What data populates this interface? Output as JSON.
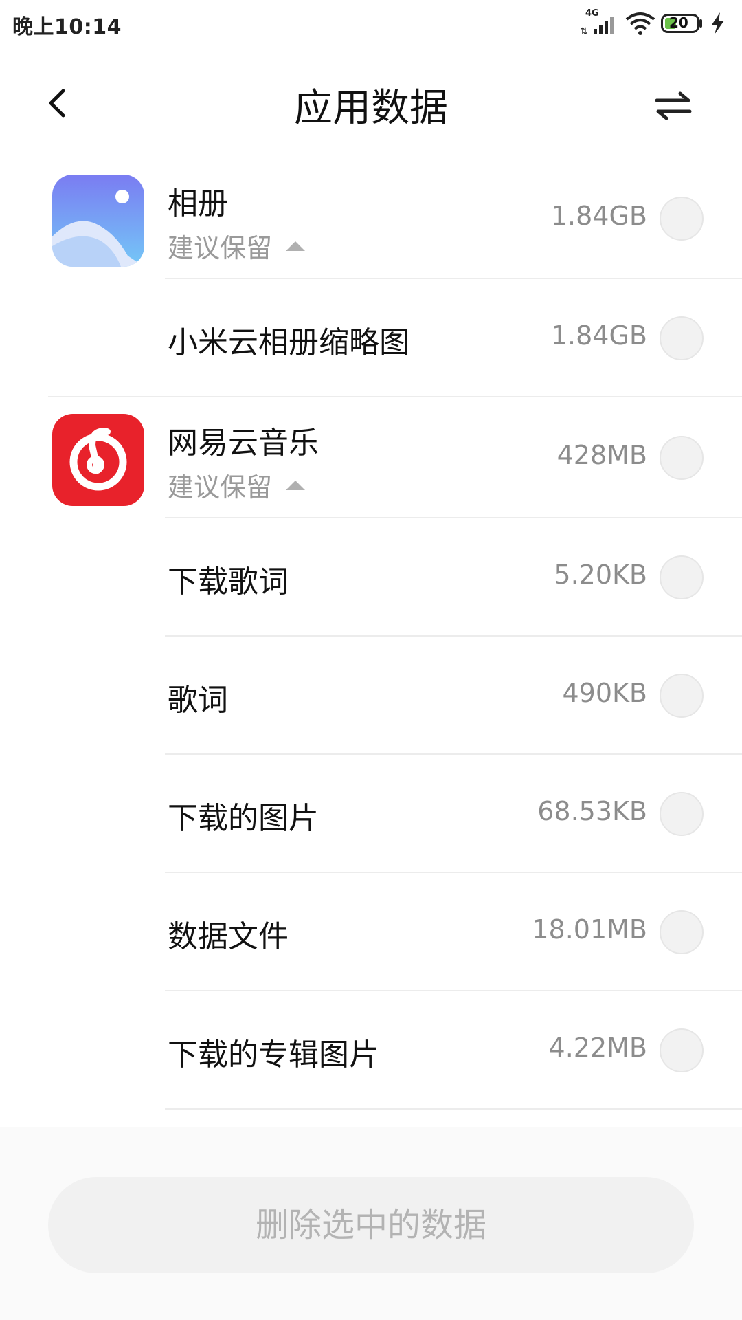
{
  "status_bar": {
    "time": "晚上10:14",
    "network": "4G",
    "battery": "20"
  },
  "header": {
    "title": "应用数据"
  },
  "icons": {
    "back": "back-arrow-icon",
    "sort": "sort-swap-icon",
    "gallery": "gallery-app-icon",
    "music": "netease-music-app-icon"
  },
  "list": {
    "gallery": {
      "title": "相册",
      "subtitle": "建议保留",
      "size": "1.84GB"
    },
    "gallery_items": [
      {
        "title": "小米云相册缩略图",
        "size": "1.84GB"
      }
    ],
    "music": {
      "title": "网易云音乐",
      "subtitle": "建议保留",
      "size": "428MB"
    },
    "music_items": [
      {
        "title": "下载歌词",
        "size": "5.20KB"
      },
      {
        "title": "歌词",
        "size": "490KB"
      },
      {
        "title": "下载的图片",
        "size": "68.53KB"
      },
      {
        "title": "数据文件",
        "size": "18.01MB"
      },
      {
        "title": "下载的专辑图片",
        "size": "4.22MB"
      }
    ]
  },
  "footer": {
    "delete_label": "删除选中的数据"
  },
  "colors": {
    "music_red": "#e8222b",
    "gallery_blue": "#7aa8f8"
  }
}
